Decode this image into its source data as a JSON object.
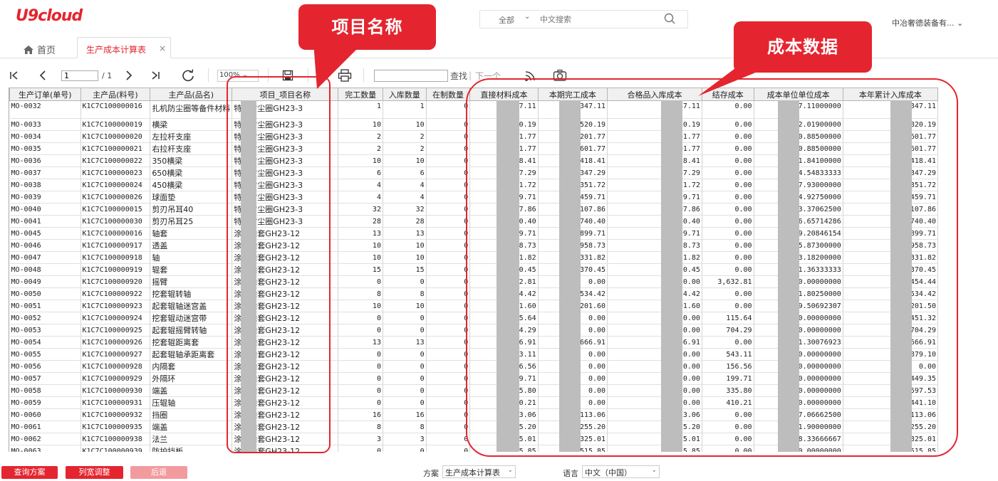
{
  "app": {
    "logo": "U9cloud"
  },
  "search": {
    "scope": "全部",
    "placeholder": "中文搜索"
  },
  "user": {
    "name": "中冶奢德装备有..."
  },
  "tabs": {
    "home": "首页",
    "active": "生产成本计算表"
  },
  "toolbar": {
    "page_value": "1",
    "page_total": "/ 1",
    "zoom": "100%",
    "find_label": "查找",
    "next_label": "下一个"
  },
  "columns": [
    "生产订单(单号)",
    "主产品(料号)",
    "主产品(品名)",
    "项目_项目名称",
    "完工数量",
    "入库数量",
    "在制数量",
    "直接材料成本",
    "本期完工成本",
    "合格品入库成本",
    "结存成本",
    "成本单位单位成本",
    "本年累计入库成本"
  ],
  "rows": [
    [
      "MO-0032",
      "K1C7C100000016",
      "扎机防尘圈等备件材料",
      "特钢防尘圈GH23-3",
      "1",
      "1",
      "0",
      "47.11",
      "347.11",
      "347.11",
      "0.00",
      "47.11000000",
      "347.11"
    ],
    [
      "MO-0033",
      "K1C7C100000019",
      "横梁",
      "特钢防尘圈GH23-3",
      "10",
      "10",
      "0",
      "20.19",
      "520.19",
      "820.19",
      "0.00",
      "82.01900000",
      "820.19"
    ],
    [
      "MO-0034",
      "K1C7C100000020",
      "左拉杆支座",
      "特钢防尘圈GH23-3",
      "2",
      "2",
      "0",
      "01.77",
      "201.77",
      "601.77",
      "0.00",
      "300.88500000",
      "601.77"
    ],
    [
      "MO-0035",
      "K1C7C100000021",
      "右拉杆支座",
      "特钢防尘圈GH23-3",
      "2",
      "2",
      "0",
      "01.77",
      "601.77",
      "601.77",
      "0.00",
      "300.88500000",
      "601.77"
    ],
    [
      "MO-0036",
      "K1C7C100000022",
      "350横梁",
      "特钢防尘圈GH23-3",
      "10",
      "10",
      "0",
      "18.41",
      "418.41",
      "418.41",
      "0.00",
      "41.84100000",
      "418.41"
    ],
    [
      "MO-0037",
      "K1C7C100000023",
      "650横梁",
      "特钢防尘圈GH23-3",
      "6",
      "6",
      "0",
      "47.29",
      "347.29",
      "347.29",
      "0.00",
      "24.54833333",
      "347.29"
    ],
    [
      "MO-0038",
      "K1C7C100000024",
      "450横梁",
      "特钢防尘圈GH23-3",
      "4",
      "4",
      "0",
      "51.72",
      "351.72",
      "351.72",
      "0.00",
      "87.93000000",
      "351.72"
    ],
    [
      "MO-0039",
      "K1C7C100000026",
      "球面垫",
      "特钢防尘圈GH23-3",
      "4",
      "4",
      "0",
      "59.71",
      "459.71",
      "459.71",
      "0.00",
      "114.92750000",
      "459.71"
    ],
    [
      "MO-0040",
      "K1C7C100000015",
      "剪刃吊耳40",
      "特钢防尘圈GH23-3",
      "32",
      "32",
      "0",
      "07.86",
      "107.86",
      "107.86",
      "0.00",
      "3.37062500",
      "107.86"
    ],
    [
      "MO-0041",
      "K1C7C100000030",
      "剪刃吊耳25",
      "特钢防尘圈GH23-3",
      "28",
      "28",
      "0",
      "40.40",
      "740.40",
      "740.40",
      "0.00",
      "26.65714286",
      "740.40"
    ],
    [
      "MO-0045",
      "K1C7C100000016",
      "轴套",
      "涂钢涂套GH23-12",
      "13",
      "13",
      "0",
      "99.71",
      "899.71",
      "899.71",
      "0.00",
      "69.20846154",
      "899.71"
    ],
    [
      "MO-0046",
      "K1C7C100000917",
      "透盖",
      "涂钢涂套GH23-12",
      "10",
      "10",
      "0",
      "58.73",
      "958.73",
      "958.73",
      "0.00",
      "95.87300000",
      "958.73"
    ],
    [
      "MO-0047",
      "K1C7C100000918",
      "轴",
      "涂钢涂套GH23-12",
      "10",
      "10",
      "0",
      "31.82",
      "331.82",
      "331.82",
      "0.00",
      "33.18200000",
      "331.82"
    ],
    [
      "MO-0048",
      "K1C7C100000919",
      "辊套",
      "涂钢涂套GH23-12",
      "15",
      "15",
      "0",
      "70.45",
      "370.45",
      "370.45",
      "0.00",
      "91.36333333",
      "370.45"
    ],
    [
      "MO-0049",
      "K1C7C100000920",
      "摇臂",
      "涂钢涂套GH23-12",
      "0",
      "0",
      "0",
      "82.81",
      "0.00",
      "0.00",
      "3,632.81",
      "0.00000000",
      "454.44"
    ],
    [
      "MO-0050",
      "K1C7C100000922",
      "挖套辊转轴",
      "涂钢涂套GH23-12",
      "8",
      "8",
      "0",
      "34.42",
      "534.42",
      "534.42",
      "0.00",
      "41.80250000",
      "534.42"
    ],
    [
      "MO-0051",
      "K1C7C100000923",
      "起套辊轴迷宫盖",
      "涂钢涂套GH23-12",
      "10",
      "10",
      "0",
      "01.60",
      "201.60",
      "201.60",
      "0.00",
      "69.50692307",
      "201.50"
    ],
    [
      "MO-0052",
      "K1C7C100000924",
      "挖套辊动迷宫带",
      "涂钢涂套GH23-12",
      "0",
      "0",
      "0",
      "15.64",
      "0.00",
      "0.00",
      "115.64",
      "0.00000000",
      "451.32"
    ],
    [
      "MO-0053",
      "K1C7C100000925",
      "起套辊摇臂转轴",
      "涂钢涂套GH23-12",
      "0",
      "0",
      "0",
      "04.29",
      "0.00",
      "0.00",
      "704.29",
      "0.00000000",
      "704.29"
    ],
    [
      "MO-0054",
      "K1C7C100000926",
      "挖套辊距离套",
      "涂钢涂套GH23-12",
      "13",
      "13",
      "0",
      "66.91",
      "666.91",
      "666.91",
      "0.00",
      "51.30076923",
      "666.91"
    ],
    [
      "MO-0055",
      "K1C7C100000927",
      "起套辊轴承距离套",
      "涂钢涂套GH23-12",
      "0",
      "0",
      "0",
      "43.11",
      "0.00",
      "0.00",
      "543.11",
      "0.00000000",
      "879.10"
    ],
    [
      "MO-0056",
      "K1C7C100000928",
      "内隔套",
      "涂钢涂套GH23-12",
      "0",
      "0",
      "0",
      "56.56",
      "0.00",
      "0.00",
      "156.56",
      "0.00000000",
      "0.00"
    ],
    [
      "MO-0057",
      "K1C7C100000929",
      "外隔环",
      "涂钢涂套GH23-12",
      "0",
      "0",
      "0",
      "39.71",
      "0.00",
      "0.00",
      "199.71",
      "0.00000000",
      "449.35"
    ],
    [
      "MO-0058",
      "K1C7C100000930",
      "端盖",
      "涂钢涂套GH23-12",
      "0",
      "0",
      "0",
      "35.80",
      "0.00",
      "0.00",
      "335.80",
      "0.00000000",
      "597.53"
    ],
    [
      "MO-0059",
      "K1C7C100000931",
      "压辊轴",
      "涂钢涂套GH23-12",
      "0",
      "0",
      "0",
      "10.21",
      "0.00",
      "0.00",
      "410.21",
      "0.00000000",
      "441.10"
    ],
    [
      "MO-0060",
      "K1C7C100000932",
      "挡圈",
      "涂钢涂套GH23-12",
      "16",
      "16",
      "0",
      "13.06",
      "113.06",
      "113.06",
      "0.00",
      "7.06662500",
      "113.06"
    ],
    [
      "MO-0061",
      "K1C7C100000935",
      "端盖",
      "涂钢涂套GH23-12",
      "8",
      "8",
      "0",
      "55.20",
      "255.20",
      "255.20",
      "0.00",
      "31.90000000",
      "255.20"
    ],
    [
      "MO-0062",
      "K1C7C100000938",
      "法兰",
      "涂钢涂套GH23-12",
      "3",
      "3",
      "0",
      "25.01",
      "325.01",
      "325.01",
      "0.00",
      "108.33666667",
      "325.01"
    ],
    [
      "MO-0063",
      "K1C7C100000939",
      "防护挡板",
      "涂钢涂套GH23-12",
      "0",
      "0",
      "0",
      "15.85",
      "515.85",
      "515.85",
      "0.00",
      "0.00000000",
      "515.85"
    ]
  ],
  "footer": {
    "query_btn": "查询方案",
    "columns_btn": "列宽调整",
    "back_btn": "后退",
    "plan_label": "方案",
    "plan_value": "生产成本计算表",
    "lang_label": "语言",
    "lang_value": "中文（中国）"
  },
  "callouts": {
    "project_name": "项目名称",
    "cost_data": "成本数据"
  },
  "colors": {
    "brand": "#e4252f",
    "disabled": "#f29b9f"
  }
}
